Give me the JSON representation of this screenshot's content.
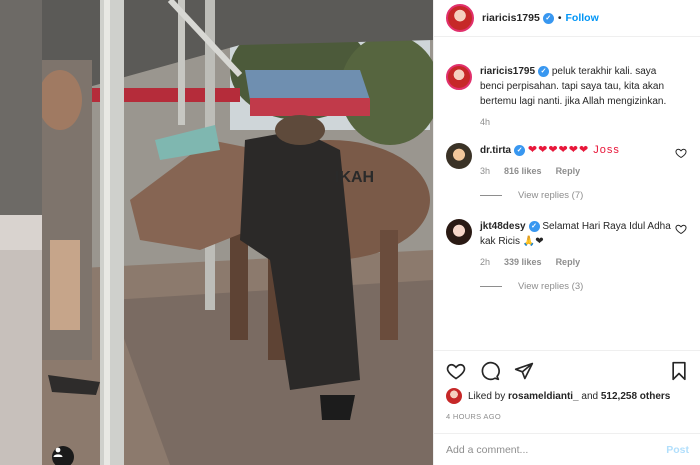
{
  "post": {
    "author": "riaricis1795",
    "follow_label": "Follow",
    "separator": "•",
    "caption": "peluk terakhir kali. saya benci perpisahan. tapi saya tau, kita akan bertemu lagi nanti. jika Allah mengizinkan.",
    "caption_time": "4h"
  },
  "comments": [
    {
      "username": "dr.tirta",
      "text": "❤❤❤❤❤❤ Joss",
      "time": "3h",
      "likes": "816 likes",
      "reply_label": "Reply",
      "view_replies": "View replies (7)"
    },
    {
      "username": "jkt48desy",
      "text": "Selamat Hari Raya Idul Adha kak Ricis 🙏❤",
      "time": "2h",
      "likes": "339 likes",
      "reply_label": "Reply",
      "view_replies": "View replies (3)"
    }
  ],
  "likes_line": {
    "prefix": "Liked by",
    "user": "rosameldianti_",
    "conjunction": "and",
    "count": "512,258 others"
  },
  "timestamp": "4 HOURS AGO",
  "comment_box": {
    "placeholder": "Add a comment...",
    "post_label": "Post"
  },
  "photo": {
    "sign_text": "IKAH"
  },
  "icons": {
    "like": "heart-icon",
    "comment": "comment-icon",
    "share": "share-icon",
    "save": "bookmark-icon",
    "verified": "verified-badge-icon",
    "user_tags": "user-tag-icon"
  },
  "colors": {
    "accent": "#0095f6",
    "verified": "#3897f0",
    "heart": "#e8173a",
    "muted": "#8e8e8e"
  }
}
